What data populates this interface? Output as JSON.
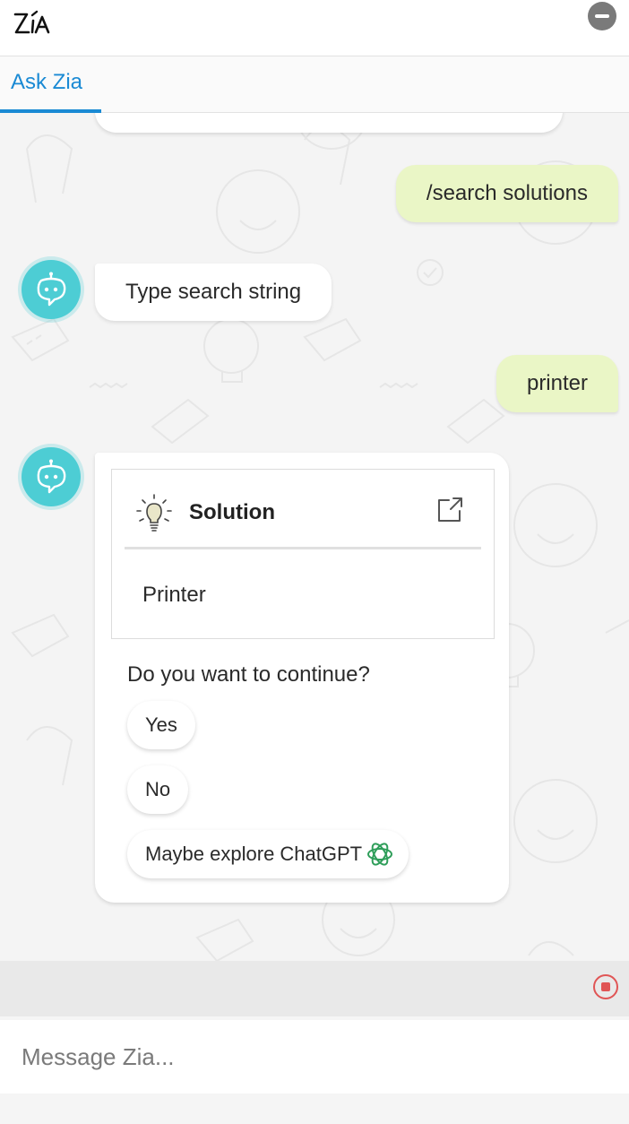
{
  "header": {
    "logo_text": "Zia",
    "minimize_icon": "minus-circle-icon"
  },
  "tabs": [
    {
      "label": "Ask Zia",
      "active": true
    }
  ],
  "conversation": {
    "user_command": "/search solutions",
    "bot_prompt": "Type search string",
    "user_query": "printer",
    "solution_card": {
      "icon": "lightbulb-icon",
      "title": "Solution",
      "open_icon": "external-link-icon",
      "items": [
        "Printer"
      ]
    },
    "question": "Do you want to continue?",
    "options": [
      "Yes",
      "No",
      "Maybe explore ChatGPT"
    ],
    "option_icon": "chatgpt-icon"
  },
  "composer": {
    "placeholder": "Message Zia...",
    "stop_icon": "stop-icon"
  },
  "colors": {
    "accent": "#1a8ad4",
    "avatar": "#4dcdd4",
    "user_bubble": "#eaf6c6",
    "stop": "#e05555"
  }
}
